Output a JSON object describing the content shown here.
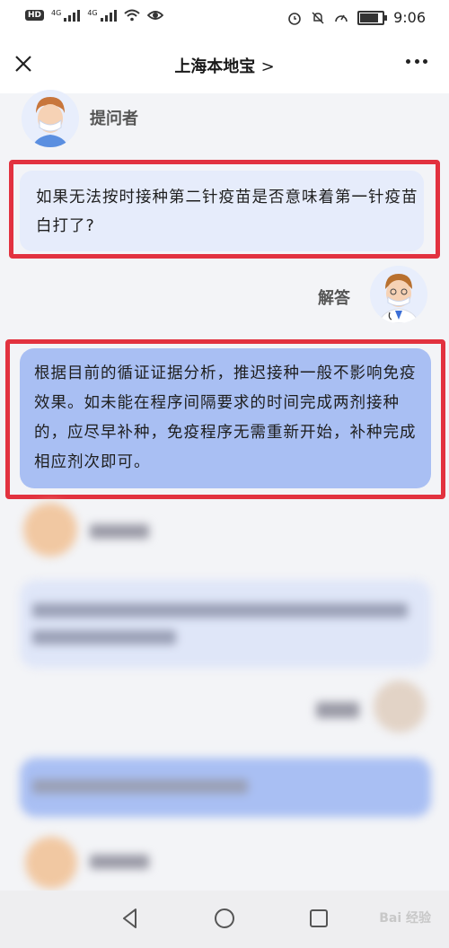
{
  "status_bar": {
    "hd": "HD",
    "net1": "4G",
    "net2": "4G",
    "battery_level": 0.85,
    "time": "9:06",
    "icons": [
      "wifi-icon",
      "eye-icon",
      "alarm-icon",
      "mute-icon",
      "speed-icon",
      "battery-icon"
    ]
  },
  "header": {
    "title": "上海本地宝",
    "title_arrow": ">",
    "left_icon": "close-icon",
    "right_icon": "more-icon"
  },
  "chat": {
    "asker_label": "提问者",
    "question": "如果无法按时接种第二针疫苗是否意味着第一针疫苗白打了?",
    "answerer_label": "解答",
    "answer": "根据目前的循证证据分析，推迟接种一般不影响免疫效果。如未能在程序间隔要求的时间完成两剂接种的，应尽早补种，免疫程序无需重新开始，补种完成相应剂次即可。"
  },
  "colors": {
    "question_bubble": "#e6ecfb",
    "answer_bubble": "#a9bff3",
    "highlight": "#e2323f"
  },
  "nav": {
    "back_icon": "back-triangle-icon",
    "home_icon": "home-circle-icon",
    "recent_icon": "recent-square-icon"
  },
  "watermark": "Bai 经验"
}
